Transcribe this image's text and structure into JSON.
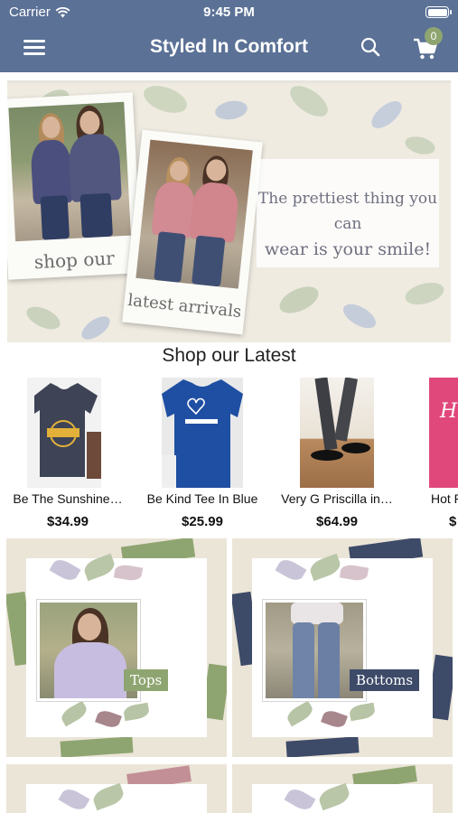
{
  "status_bar": {
    "carrier": "Carrier",
    "time": "9:45 PM"
  },
  "nav": {
    "title": "Styled In Comfort",
    "cart_count": "0"
  },
  "hero": {
    "caption_left": "shop our",
    "caption_right": "latest arrivals",
    "quote_line1": "The prettiest thing you can",
    "quote_line2": "wear is your smile!"
  },
  "latest": {
    "title": "Shop our Latest",
    "products": [
      {
        "name": "Be The Sunshine…",
        "price": "$34.99"
      },
      {
        "name": "Be Kind Tee In Blue",
        "price": "$25.99"
      },
      {
        "name": "Very G Priscilla in…",
        "price": "$64.99"
      },
      {
        "name": "Hot Pi",
        "price": "$"
      }
    ]
  },
  "categories": [
    {
      "label": "Tops"
    },
    {
      "label": "Bottoms"
    }
  ],
  "colors": {
    "nav_bar": "#5b7196",
    "badge": "#8fa571",
    "tag_green": "#8fa571",
    "tag_navy": "#3d4a68"
  }
}
